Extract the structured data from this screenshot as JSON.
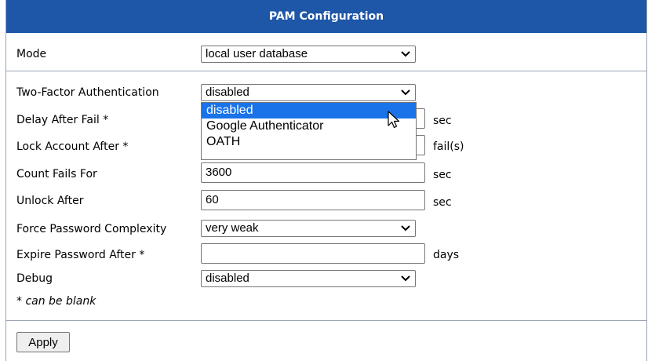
{
  "header": {
    "title": "PAM Configuration"
  },
  "fields": {
    "mode": {
      "label": "Mode",
      "value": "local user database"
    },
    "two_factor": {
      "label": "Two-Factor Authentication",
      "value": "disabled"
    },
    "delay_after_fail": {
      "label": "Delay After Fail *",
      "value": "",
      "unit": "sec"
    },
    "lock_account_after": {
      "label": "Lock Account After *",
      "value": "",
      "unit": "fail(s)"
    },
    "count_fails_for": {
      "label": "Count Fails For",
      "value": "3600",
      "unit": "sec"
    },
    "unlock_after": {
      "label": "Unlock After",
      "value": "60",
      "unit": "sec"
    },
    "password_complexity": {
      "label": "Force Password Complexity",
      "value": "very weak"
    },
    "expire_password_after": {
      "label": "Expire Password After *",
      "value": "",
      "unit": "days"
    },
    "debug": {
      "label": "Debug",
      "value": "disabled"
    }
  },
  "note": "* can be blank",
  "apply_label": "Apply",
  "dropdown": {
    "options": [
      "disabled",
      "Google Authenticator",
      "OATH"
    ],
    "selected_index": 0
  },
  "colors": {
    "header_bg": "#1e56a8",
    "highlight": "#1a73e8",
    "border": "#9aa3b3"
  }
}
